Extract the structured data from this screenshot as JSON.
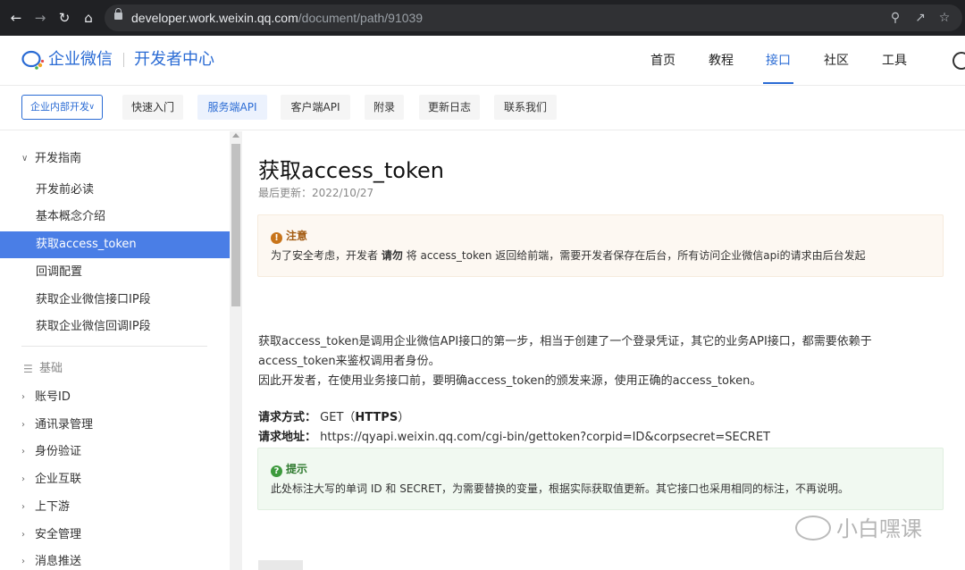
{
  "browser": {
    "url_host": "developer.work.weixin.qq.com",
    "url_path": "/document/path/91039",
    "icons": [
      "back-icon",
      "forward-icon",
      "reload-icon",
      "home-icon",
      "lock-icon",
      "zoom-icon",
      "share-icon",
      "bookmark-star-icon"
    ]
  },
  "header": {
    "logo_text": "企业微信",
    "logo_sub": "开发者中心",
    "nav": [
      "首页",
      "教程",
      "接口",
      "社区",
      "工具"
    ],
    "active_nav": "接口",
    "accent_color": "#2a6bd4"
  },
  "subbar": {
    "dropdown_label": "企业内部开发",
    "tabs": [
      "快速入门",
      "服务端API",
      "客户端API",
      "附录",
      "更新日志",
      "联系我们"
    ],
    "active_tab": "服务端API"
  },
  "sidebar": {
    "guide_group": "开发指南",
    "guide_items": [
      "开发前必读",
      "基本概念介绍",
      "获取access_token",
      "回调配置",
      "获取企业微信接口IP段",
      "获取企业微信回调IP段"
    ],
    "active_item": "获取access_token",
    "section_label": "基础",
    "groups": [
      "账号ID",
      "通讯录管理",
      "身份验证",
      "企业互联",
      "上下游",
      "安全管理",
      "消息推送"
    ]
  },
  "content": {
    "title": "获取access_token",
    "updated": "最后更新：2022/10/27",
    "notice": {
      "title": "注意",
      "badge": "!",
      "text_before": "为了安全考虑，开发者 ",
      "text_bold": "请勿",
      "text_after": " 将 access_token 返回给前端，需要开发者保存在后台，所有访问企业微信api的请求由后台发起"
    },
    "intro_line1": "获取access_token是调用企业微信API接口的第一步，相当于创建了一个登录凭证，其它的业务API接口，都需要依赖于access_token来鉴权调用者身份。",
    "intro_line2": "因此开发者，在使用业务接口前，要明确access_token的颁发来源，使用正确的access_token。",
    "request_method_label": "请求方式：",
    "request_method_value": "GET（",
    "request_method_bold": "HTTPS",
    "request_method_close": "）",
    "request_url_label": "请求地址：",
    "request_url_value": "https://qyapi.weixin.qq.com/cgi-bin/gettoken?corpid=ID&corpsecret=SECRET",
    "tip": {
      "title": "提示",
      "badge": "?",
      "text": "此处标注大写的单词 ID 和 SECRET，为需要替换的变量，根据实际获取值更新。其它接口也采用相同的标注，不再说明。"
    }
  },
  "watermark": "小白嘿课"
}
